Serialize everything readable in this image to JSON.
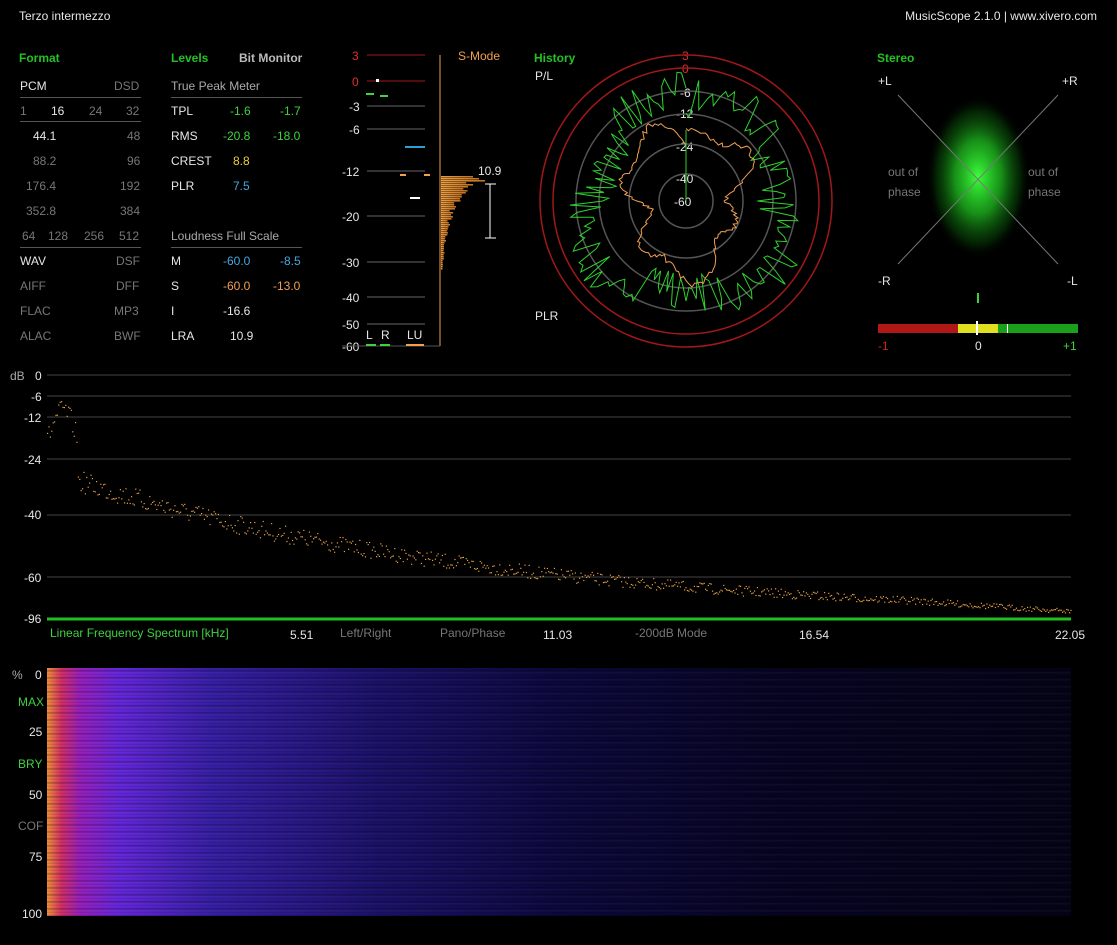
{
  "window": {
    "title": "Terzo intermezzo",
    "app": "MusicScope 2.1.0 | www.xivero.com"
  },
  "format": {
    "header": "Format",
    "pcm": "PCM",
    "dsd": "DSD",
    "bits": [
      "1",
      "16",
      "24",
      "32"
    ],
    "rates": [
      [
        "44.1",
        "48"
      ],
      [
        "88.2",
        "96"
      ],
      [
        "176.4",
        "192"
      ],
      [
        "352.8",
        "384"
      ]
    ],
    "dsd_rates": [
      "64",
      "128",
      "256",
      "512"
    ],
    "types": [
      [
        "WAV",
        "DSF"
      ],
      [
        "AIFF",
        "DFF"
      ],
      [
        "FLAC",
        "MP3"
      ],
      [
        "ALAC",
        "BWF"
      ]
    ]
  },
  "levels": {
    "header": "Levels",
    "bit_monitor": "Bit Monitor",
    "tp_title": "True Peak Meter",
    "rows": [
      {
        "label": "TPL",
        "l": "-1.6",
        "r": "-1.7"
      },
      {
        "label": "RMS",
        "l": "-20.8",
        "r": "-18.0"
      },
      {
        "label": "CREST",
        "l": "8.8",
        "r": ""
      },
      {
        "label": "PLR",
        "l": "7.5",
        "r": ""
      }
    ],
    "lfs_title": "Loudness Full Scale",
    "lfs_rows": [
      {
        "label": "M",
        "l": "-60.0",
        "r": "-8.5"
      },
      {
        "label": "S",
        "l": "-60.0",
        "r": "-13.0"
      },
      {
        "label": "I",
        "l": "-16.6",
        "r": ""
      },
      {
        "label": "LRA",
        "l": "10.9",
        "r": ""
      }
    ]
  },
  "meter": {
    "scale": [
      "3",
      "0",
      "-3",
      "-6",
      "-12",
      "-20",
      "-30",
      "-40",
      "-50",
      "-60"
    ],
    "s_mode": "S-Mode",
    "lra_value": "10.9",
    "labels": {
      "l": "L",
      "r": "R",
      "lu": "LU"
    }
  },
  "history": {
    "header": "History",
    "pl": "P/L",
    "plr": "PLR",
    "rings": [
      "3",
      "0",
      "-6",
      "-12",
      "-24",
      "-40",
      "-60"
    ]
  },
  "stereo": {
    "header": "Stereo",
    "pl": "+L",
    "pr": "+R",
    "nr": "-R",
    "nl": "-L",
    "oop_left": "out of phase",
    "oop_right": "out of phase",
    "corr": {
      "min": "-1",
      "mid": "0",
      "max": "+1",
      "value": 0.05
    }
  },
  "spectrum": {
    "unit": "dB",
    "y_ticks": [
      "0",
      "-6",
      "-12",
      "-24",
      "-40",
      "-60",
      "-96"
    ],
    "x_title": "Linear Frequency Spectrum [kHz]",
    "x_ticks": [
      "5.51",
      "11.03",
      "16.54",
      "22.05"
    ],
    "buttons": [
      "Left/Right",
      "Pano/Phase",
      "-200dB Mode"
    ]
  },
  "spectrogram": {
    "unit": "%",
    "ticks": [
      "0",
      "25",
      "50",
      "75",
      "100"
    ],
    "markers": [
      "MAX",
      "BRY",
      "COF"
    ]
  },
  "colors": {
    "green": "#23c123",
    "blue": "#48a6e0",
    "orange": "#f0a050",
    "red": "#b01818"
  }
}
